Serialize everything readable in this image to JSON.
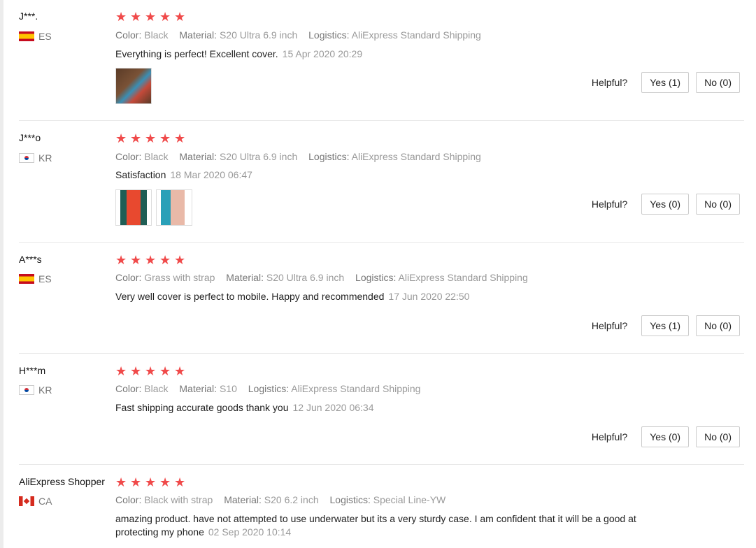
{
  "helpful_label": "Helpful?",
  "star_color": "#f04a4a",
  "labels": {
    "color": "Color:",
    "material": "Material:",
    "logistics": "Logistics:"
  },
  "reviews": [
    {
      "user": "J***.",
      "country": "ES",
      "rating": 5,
      "color": "Black",
      "material": "S20 Ultra 6.9 inch",
      "logistics": "AliExpress Standard Shipping",
      "text": "Everything is perfect! Excellent cover.",
      "date": "15 Apr 2020 20:29",
      "yes": "Yes (1)",
      "no": "No (0)"
    },
    {
      "user": "J***o",
      "country": "KR",
      "rating": 5,
      "color": "Black",
      "material": "S20 Ultra 6.9 inch",
      "logistics": "AliExpress Standard Shipping",
      "text": "Satisfaction",
      "date": "18 Mar 2020 06:47",
      "yes": "Yes (0)",
      "no": "No (0)"
    },
    {
      "user": "A***s",
      "country": "ES",
      "rating": 5,
      "color": "Grass with strap",
      "material": "S20 Ultra 6.9 inch",
      "logistics": "AliExpress Standard Shipping",
      "text": "Very well cover is perfect to mobile. Happy and recommended",
      "date": "17 Jun 2020 22:50",
      "yes": "Yes (1)",
      "no": "No (0)"
    },
    {
      "user": "H***m",
      "country": "KR",
      "rating": 5,
      "color": "Black",
      "material": "S10",
      "logistics": "AliExpress Standard Shipping",
      "text": "Fast shipping accurate goods thank you",
      "date": "12 Jun 2020 06:34",
      "yes": "Yes (0)",
      "no": "No (0)"
    },
    {
      "user": "AliExpress Shopper",
      "country": "CA",
      "rating": 5,
      "color": "Black with strap",
      "material": "S20 6.2 inch",
      "logistics": "Special Line-YW",
      "text": "amazing product. have not attempted to use underwater but its a very sturdy case. I am confident that it will be a good at protecting my phone",
      "date": "02 Sep 2020 10:14"
    }
  ]
}
